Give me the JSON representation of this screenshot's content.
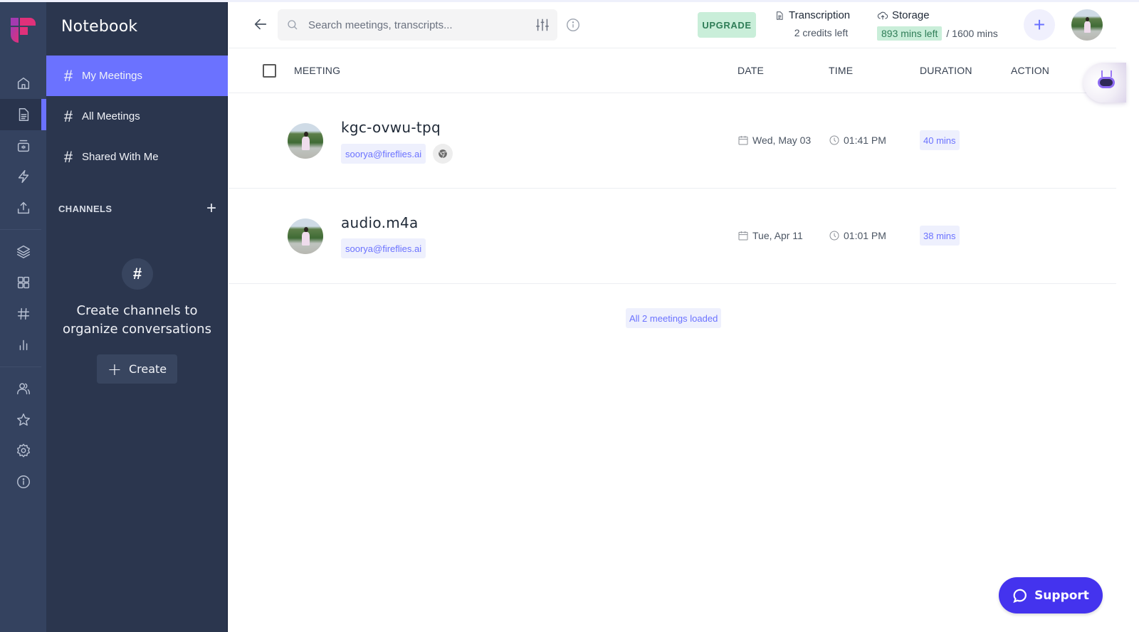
{
  "app": {
    "brand_colors": {
      "logo_pink": "#e0317a",
      "logo_purple": "#a43ab0",
      "accent": "#6b72ff",
      "support": "#4433ee",
      "upgrade_bg": "#c9eed9",
      "upgrade_text": "#2f7d57"
    }
  },
  "rail": {
    "items": [
      {
        "icon": "home-icon",
        "active": false
      },
      {
        "icon": "notebook-icon",
        "active": true
      },
      {
        "icon": "meetings-icon",
        "active": false
      },
      {
        "icon": "lightning-icon",
        "active": false
      },
      {
        "icon": "upload-icon",
        "active": false
      },
      {
        "icon": "layers-icon",
        "active": false
      },
      {
        "icon": "apps-grid-icon",
        "active": false
      },
      {
        "icon": "hashtag-icon",
        "active": false
      },
      {
        "icon": "analytics-icon",
        "active": false
      },
      {
        "icon": "team-icon",
        "active": false
      },
      {
        "icon": "star-icon",
        "active": false
      },
      {
        "icon": "settings-icon",
        "active": false
      },
      {
        "icon": "info-icon",
        "active": false
      }
    ]
  },
  "sidebar": {
    "title": "Notebook",
    "items": [
      {
        "icon": "#",
        "label": "My Meetings",
        "active": true
      },
      {
        "icon": "#",
        "label": "All Meetings",
        "active": false
      },
      {
        "icon": "#",
        "label": "Shared With Me",
        "active": false
      }
    ],
    "channels_label": "CHANNELS",
    "channels_add": "+",
    "empty_icon": "#",
    "empty_text": "Create channels to organize conversations",
    "create_plus": "+",
    "create_label": "Create"
  },
  "header": {
    "search_placeholder": "Search meetings, transcripts...",
    "search_value": "",
    "upgrade_label": "UPGRADE",
    "transcription_title": "Transcription",
    "transcription_sub": "2 credits left",
    "storage_title": "Storage",
    "storage_left": "893 mins left",
    "storage_total": "/ 1600 mins",
    "add_label": "+"
  },
  "table": {
    "columns": [
      "MEETING",
      "DATE",
      "TIME",
      "DURATION",
      "ACTION"
    ],
    "rows": [
      {
        "title": "kgc-ovwu-tpq",
        "owner": "soorya@fireflies.ai",
        "source_icon": "chrome-icon",
        "date": "Wed, May 03",
        "time": "01:41 PM",
        "duration": "40 mins"
      },
      {
        "title": "audio.m4a",
        "owner": "soorya@fireflies.ai",
        "source_icon": null,
        "date": "Tue, Apr 11",
        "time": "01:01 PM",
        "duration": "38 mins"
      }
    ],
    "status": "All 2 meetings loaded"
  },
  "support": {
    "label": "Support"
  }
}
